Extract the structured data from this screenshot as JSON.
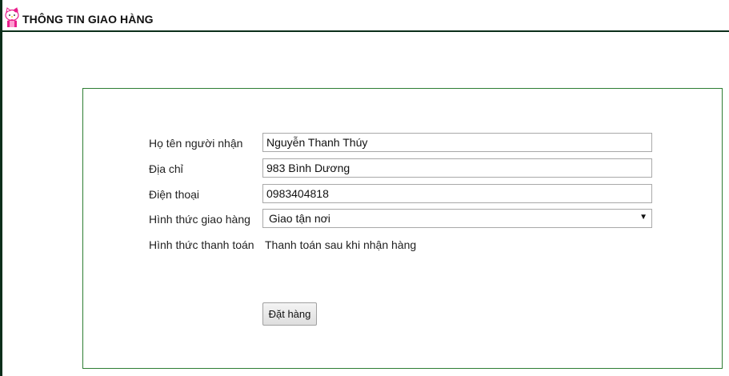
{
  "header": {
    "title": "THÔNG TIN GIAO HÀNG",
    "logo_icon": "hello-kitty-icon"
  },
  "form": {
    "recipient_name": {
      "label": "Họ tên người nhận",
      "value": "Nguyễn Thanh Thúy"
    },
    "address": {
      "label": "Địa chỉ",
      "value": "983 Bình Dương"
    },
    "phone": {
      "label": "Điện thoại",
      "value": "0983404818"
    },
    "delivery_method": {
      "label": "Hình thức giao hàng",
      "selected": "Giao tận nơi"
    },
    "payment_method": {
      "label": "Hình thức thanh toán",
      "value": "Thanh toán sau khi nhận hàng"
    },
    "submit_label": "Đặt hàng"
  },
  "colors": {
    "panel_border": "#2e7d32",
    "header_rule": "#0b2e1a",
    "logo_accent": "#e91e8c"
  }
}
